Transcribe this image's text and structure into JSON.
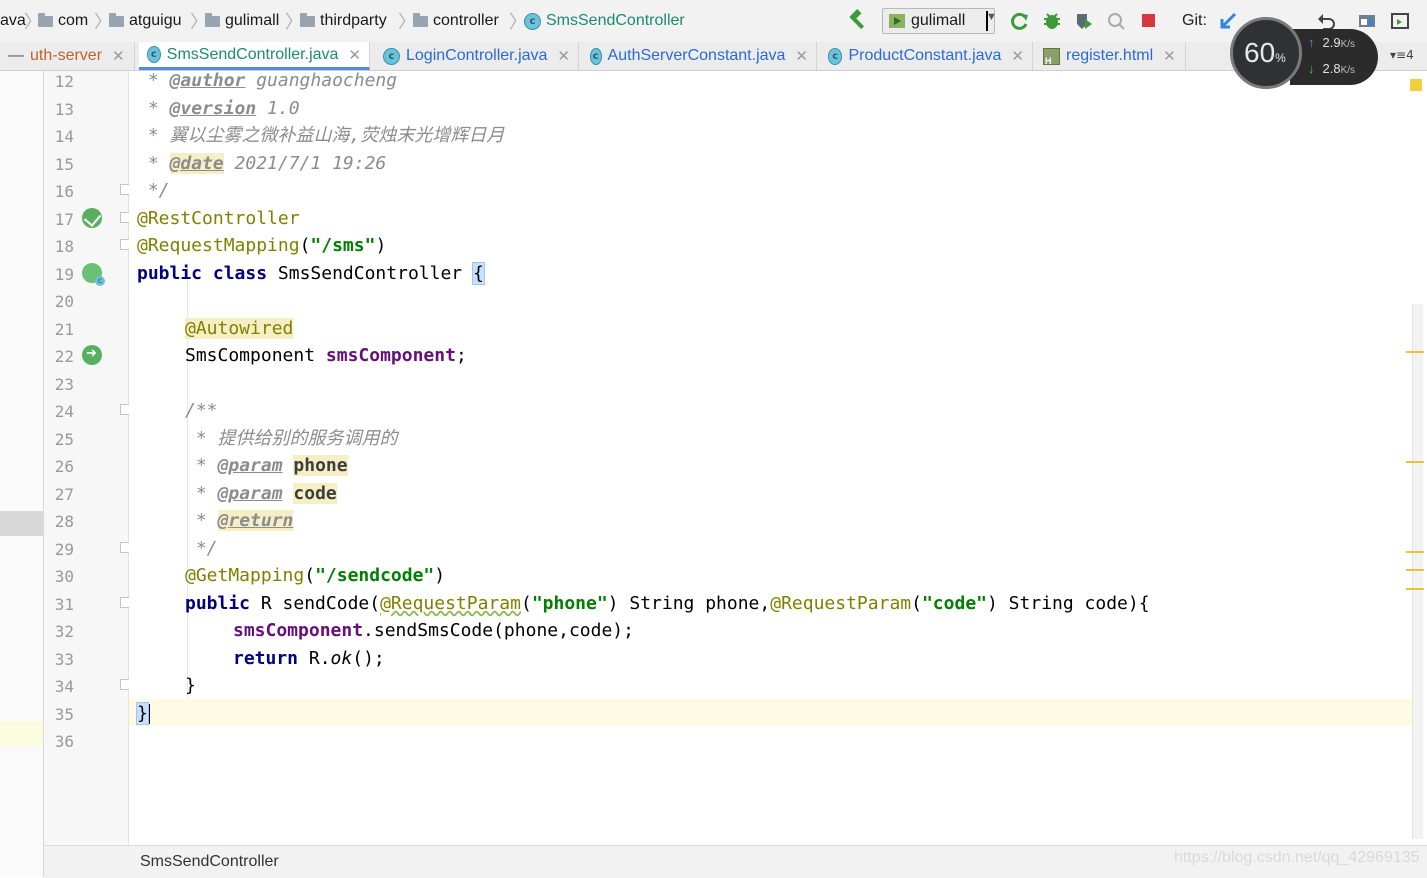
{
  "breadcrumb": {
    "items": [
      "ava",
      "com",
      "atguigu",
      "gulimall",
      "thirdparty",
      "controller",
      "SmsSendController"
    ]
  },
  "toolbar": {
    "run_config": "gulimall",
    "git_label": "Git:"
  },
  "tabs": [
    {
      "label": "uth-server",
      "icon": "module-icon"
    },
    {
      "label": "SmsSendController.java",
      "icon": "class-icon",
      "active": true
    },
    {
      "label": "LoginController.java",
      "icon": "class-icon"
    },
    {
      "label": "AuthServerConstant.java",
      "icon": "class-icon"
    },
    {
      "label": "ProductConstant.java",
      "icon": "class-icon"
    },
    {
      "label": "register.html",
      "icon": "html-file-icon"
    }
  ],
  "tabs_overflow": "▾≡4",
  "net_monitor": {
    "percent": "60",
    "percent_unit": "%",
    "upload": "2.9",
    "download": "2.8",
    "unit": "K/s"
  },
  "editor": {
    "line_numbers": [
      "12",
      "13",
      "14",
      "15",
      "16",
      "17",
      "18",
      "19",
      "20",
      "21",
      "22",
      "23",
      "24",
      "25",
      "26",
      "27",
      "28",
      "29",
      "30",
      "31",
      "32",
      "33",
      "34",
      "35",
      "36"
    ],
    "current_line": "35",
    "code": {
      "l12_a": " * ",
      "l12_tag": "@author",
      "l12_b": " guanghaocheng",
      "l13_a": " * ",
      "l13_tag": "@version",
      "l13_b": " 1.0",
      "l14": " * 翼以尘雾之微补益山海,荧烛末光增辉日月",
      "l15_a": " * ",
      "l15_tag": "@date",
      "l15_b": " 2021/7/1 19:26",
      "l16": " */",
      "l17": "@RestController",
      "l18_ann": "@RequestMapping",
      "l18_open": "(",
      "l18_str": "\"/sms\"",
      "l18_close": ")",
      "l19_kw1": "public",
      "l19_kw2": "class",
      "l19_name": " SmsSendController ",
      "l19_brace": "{",
      "l21": "@Autowired",
      "l22_type": "SmsComponent ",
      "l22_field": "smsComponent",
      "l22_end": ";",
      "l24": "/**",
      "l25": " * 提供给别的服务调用的",
      "l26_a": " * ",
      "l26_tag": "@param",
      "l26_b": " ",
      "l26_p": "phone",
      "l27_a": " * ",
      "l27_tag": "@param",
      "l27_b": " ",
      "l27_p": "code",
      "l28_a": " * ",
      "l28_tag": "@return",
      "l29": " */",
      "l30_ann": "@GetMapping",
      "l30_open": "(",
      "l30_str": "\"/sendcode\"",
      "l30_close": ")",
      "l31_kw": "public",
      "l31_a": " R sendCode(",
      "l31_ann1": "@RequestParam",
      "l31_s1": "\"phone\"",
      "l31_b": " String phone,",
      "l31_ann2": "@RequestParam",
      "l31_s2": "\"code\"",
      "l31_c": " String code){",
      "l32_field": "smsComponent",
      "l32_rest": ".sendSmsCode(phone,code);",
      "l33_kw": "return",
      "l33_a": " R.",
      "l33_m": "ok",
      "l33_b": "();",
      "l34": "}",
      "l35": "}"
    }
  },
  "status": {
    "bottom_breadcrumb": "SmsSendController",
    "watermark": "https://blog.csdn.net/qq_42969135"
  },
  "colors": {
    "keyword": "#000080",
    "annotation": "#808000",
    "string": "#008000",
    "field": "#660e7a",
    "comment": "#8c8c8c",
    "current_line": "#fdfbe3",
    "active_tab_text": "#1c8b6e"
  }
}
